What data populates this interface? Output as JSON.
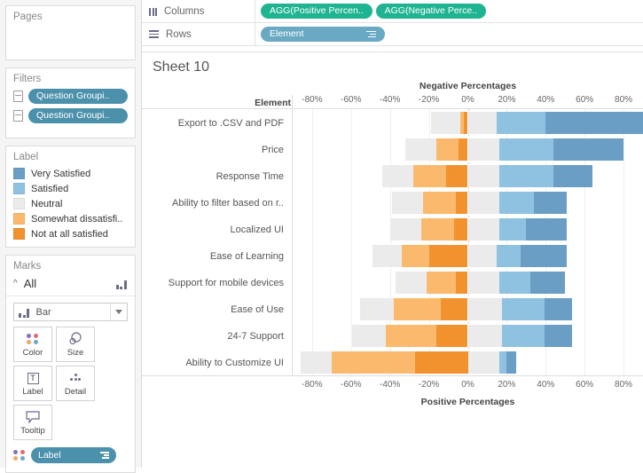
{
  "left_panel": {
    "pages": {
      "title": "Pages"
    },
    "filters": {
      "title": "Filters",
      "items": [
        {
          "label": "Question Groupi..",
          "icon": "filter-card-icon"
        },
        {
          "label": "Question Groupi..",
          "icon": "filter-card-icon"
        }
      ]
    },
    "legend": {
      "title": "Label",
      "items": [
        {
          "label": "Very Satisfied",
          "color": "#6a9ec5"
        },
        {
          "label": "Satisfied",
          "color": "#8fc2e0"
        },
        {
          "label": "Neutral",
          "color": "#ebebeb"
        },
        {
          "label": "Somewhat dissatisfi..",
          "color": "#fbb96d"
        },
        {
          "label": "Not at all satisfied",
          "color": "#f2922e"
        }
      ]
    },
    "marks": {
      "title": "Marks",
      "all_label": "All",
      "mark_type": "Bar",
      "buttons": [
        {
          "label": "Color",
          "icon": "color-dots-icon"
        },
        {
          "label": "Size",
          "icon": "size-icon"
        },
        {
          "label": "Label",
          "icon": "text-label-icon"
        },
        {
          "label": "Detail",
          "icon": "detail-dots-icon"
        },
        {
          "label": "Tooltip",
          "icon": "tooltip-icon"
        }
      ],
      "label_pill": "Label"
    }
  },
  "shelves": {
    "columns": {
      "name": "Columns",
      "pills": [
        "AGG(Positive Percen..",
        "AGG(Negative Perce.."
      ],
      "pill_color": "#1fb491"
    },
    "rows": {
      "name": "Rows",
      "pills": [
        "Element"
      ],
      "pill_color": "#6aa9c4"
    }
  },
  "worksheet": {
    "title": "Sheet 10",
    "row_header_title": "Element"
  },
  "chart_data": {
    "type": "bar",
    "subtype": "diverging-stacked-bar",
    "title": "Sheet 10",
    "top_axis_title": "Negative Percentages",
    "bottom_axis_title": "Positive Percentages",
    "ylabel": "Element",
    "xlim": [
      -90,
      90
    ],
    "grid": true,
    "legend_position": "left-panel",
    "tick_labels": [
      "-80%",
      "-60%",
      "-40%",
      "-20%",
      "0%",
      "20%",
      "40%",
      "60%",
      "80%"
    ],
    "tick_values": [
      -80,
      -60,
      -40,
      -20,
      0,
      20,
      40,
      60,
      80
    ],
    "categories": [
      "Export to .CSV and PDF",
      "Price",
      "Response Time",
      "Ability to filter based on r..",
      "Localized UI",
      "Ease of Learning",
      "Support for mobile devices",
      "Ease of Use",
      "24-7 Support",
      "Ability to Customize UI"
    ],
    "series": [
      {
        "name": "Very Satisfied",
        "color": "#6a9ec5",
        "values": [
          50,
          36,
          20,
          17,
          21,
          24,
          18,
          14,
          14,
          5
        ]
      },
      {
        "name": "Satisfied",
        "color": "#8fc2e0",
        "values": [
          25,
          28,
          28,
          18,
          14,
          12,
          16,
          22,
          22,
          4
        ]
      },
      {
        "name": "Neutral",
        "color": "#ebebeb",
        "values": [
          30,
          32,
          32,
          32,
          32,
          30,
          32,
          35,
          35,
          32
        ]
      },
      {
        "name": "Somewhat dissatisfi..",
        "color": "#fbb96d",
        "values": [
          2,
          11,
          17,
          17,
          17,
          14,
          15,
          24,
          26,
          43
        ]
      },
      {
        "name": "Not at all satisfied",
        "color": "#f2922e",
        "values": [
          2,
          5,
          11,
          6,
          7,
          20,
          6,
          14,
          16,
          27
        ]
      }
    ]
  }
}
